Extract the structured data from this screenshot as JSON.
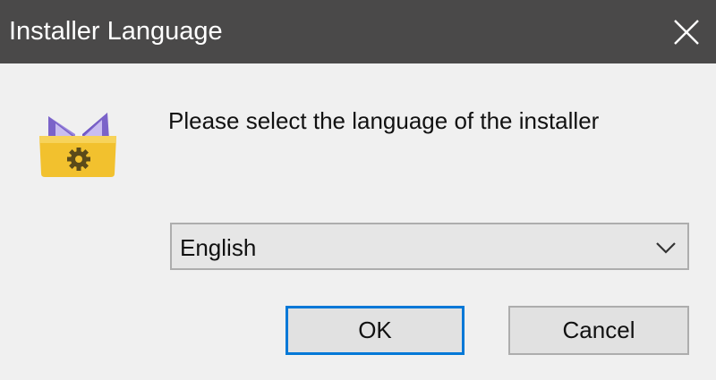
{
  "window": {
    "title": "Installer Language",
    "close_icon": "close-icon"
  },
  "dialog": {
    "app_icon": "installer-app-icon",
    "prompt": "Please select the language of the installer",
    "language_select": {
      "selected": "English",
      "chevron_icon": "chevron-down-icon"
    },
    "buttons": {
      "ok_label": "OK",
      "cancel_label": "Cancel"
    }
  },
  "colors": {
    "titlebar": "#4a4949",
    "background": "#f0f0f0",
    "focus_border": "#0078d7",
    "icon_purple": "#7b63c9",
    "icon_yellow": "#f2c12e"
  }
}
